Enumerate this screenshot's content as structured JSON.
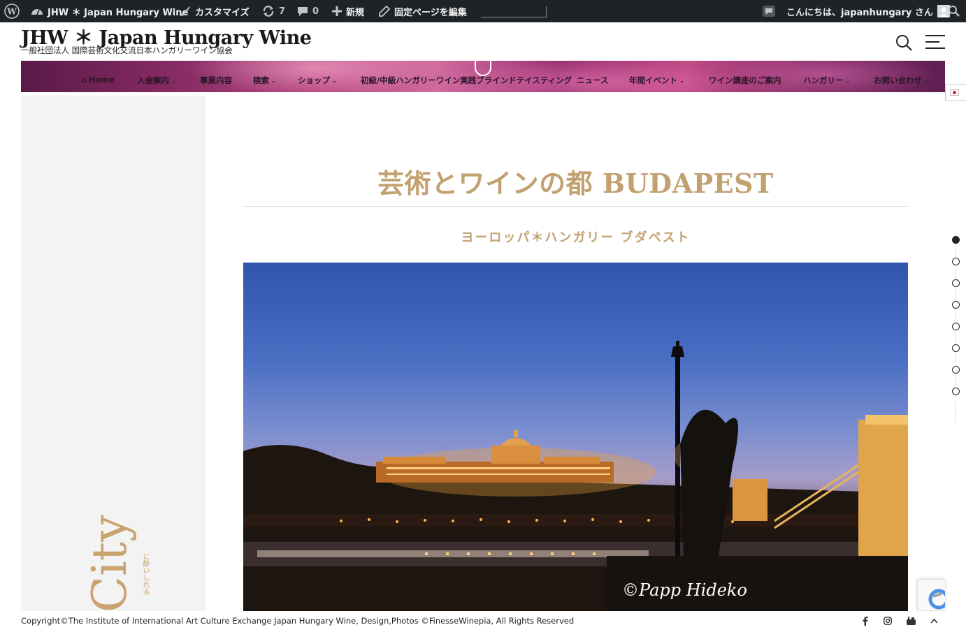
{
  "admin_bar": {
    "site_name": "JHW ＊ Japan Hungary Wine",
    "customize": "カスタマイズ",
    "updates_count": "7",
    "comments_count": "0",
    "new": "新規",
    "edit_page": "固定ページを編集",
    "greeting": "こんにちは、japanhungary さん"
  },
  "header": {
    "site_title": "JHW ＊ Japan Hungary Wine",
    "tagline": "一般社団法人 国際芸術文化交流日本ハンガリーワイン協会"
  },
  "nav": {
    "items": [
      {
        "label": "Home",
        "has_dropdown": false,
        "icon": "home-icon"
      },
      {
        "label": "入会案内",
        "has_dropdown": true
      },
      {
        "label": "事業内容",
        "has_dropdown": false
      },
      {
        "label": "検索",
        "has_dropdown": true
      },
      {
        "label": "ショップ",
        "has_dropdown": true
      },
      {
        "label": "初級/中級ハンガリーワイン実践ブラインドテイスティング",
        "has_dropdown": false
      },
      {
        "label": "ニュース",
        "has_dropdown": false
      },
      {
        "label": "年間イベント",
        "has_dropdown": true
      },
      {
        "label": "ワイン講座のご案内",
        "has_dropdown": false
      },
      {
        "label": "ハンガリー",
        "has_dropdown": true
      },
      {
        "label": "お問い合わせ",
        "has_dropdown": true
      }
    ]
  },
  "sidebar": {
    "vertical_text": "City",
    "vertical_subtext": "に酔いしれる"
  },
  "main": {
    "title": "芸術とワインの都 BUDAPEST",
    "subtitle": "ヨーロッパ＊ハンガリー ブダペスト",
    "photo_credit": "©Papp Hideko"
  },
  "dot_nav": {
    "count": 8,
    "active_index": 0
  },
  "footer": {
    "copyright": "Copyright©The Institute of International Art Culture Exchange Japan Hungary Wine, Design,Photos ©FinesseWinepia, All Rights Reserved",
    "icons": [
      "facebook-icon",
      "instagram-icon",
      "youtube-icon",
      "back-to-top-icon"
    ]
  },
  "colors": {
    "admin_bar_bg": "#1d2327",
    "accent_gold": "#c2a171",
    "nav_band": "#b9477f"
  }
}
